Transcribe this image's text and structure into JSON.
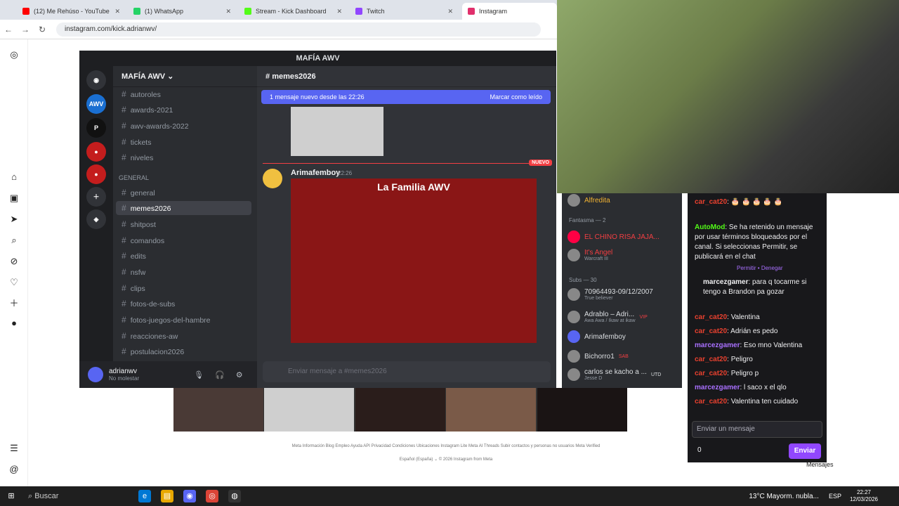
{
  "browser": {
    "tabs": [
      {
        "title": "(12) Me Rehúso - YouTube",
        "color": "#ff0000"
      },
      {
        "title": "(1) WhatsApp",
        "color": "#25d366"
      },
      {
        "title": "Stream - Kick Dashboard",
        "color": "#53fc18"
      },
      {
        "title": "Twitch",
        "color": "#9146ff"
      },
      {
        "title": "Instagram",
        "color": "#e1306c"
      }
    ],
    "url": "instagram.com/kick.adrianwv/"
  },
  "discord": {
    "window_title": "MAFÍA AWV",
    "server_name": "MAFÍA AWV",
    "channels": [
      "autoroles",
      "awards-2021",
      "awv-awards-2022",
      "tickets",
      "niveles"
    ],
    "category": "GENERAL",
    "channels2": [
      "general",
      "memes2026",
      "shitpost",
      "comandos",
      "edits",
      "nsfw",
      "clips",
      "fotos-de-subs",
      "fotos-juegos-del-hambre",
      "reacciones-aw",
      "postulacion2026"
    ],
    "current_channel": "memes2026",
    "new_bar": "1 mensaje nuevo desde las 22:26",
    "mark_read": "Marcar como leído",
    "nuevo": "NUEVO",
    "author": "Arimafemboy",
    "time": "22:26",
    "image_caption": "La Familia AWV",
    "composer_placeholder": "Enviar mensaje a #memes2026",
    "user": {
      "name": "adrianwv",
      "status": "No molestar"
    }
  },
  "members": {
    "items": [
      {
        "name": "Alfredita",
        "sub": ""
      },
      {
        "name": "EL CHINO RISA JAJA...",
        "sub": ""
      },
      {
        "name": "It's Angel",
        "sub": "Warcraft III"
      },
      {
        "name": "70964493-09/12/2007",
        "sub": "True believer"
      },
      {
        "name": "Adrablo – Adri...",
        "sub": "Awa Awa / Ikaw at ikaw"
      },
      {
        "name": "Arimafemboy",
        "sub": ""
      },
      {
        "name": "Bichorro1",
        "sub": ""
      },
      {
        "name": "carlos se kacho a ...",
        "sub": "Jesse D"
      }
    ],
    "cat1": "Fantasma — 2",
    "cat2": "Subs — 30",
    "badge_vip": "VIP",
    "badge_sab": "SAB",
    "badge_utd": "UTD"
  },
  "kick": {
    "lines": [
      {
        "user": "car_cat20",
        "text": ": 🎂 🎂 🎂 🎂 🎂"
      },
      {
        "user": "AutoMod",
        "text": ": Se ha retenido un mensaje por usar términos bloqueados por el canal. Si seleccionas Permitir, se publicará en el chat"
      },
      {
        "user": "marcezgamer",
        "text": ": para q tocarme si tengo a Brandon pa gozar"
      },
      {
        "user": "car_cat20",
        "text": ": Valentina"
      },
      {
        "user": "car_cat20",
        "text": ": Adrián es pedo"
      },
      {
        "user": "marcezgamer",
        "text": ": Eso mno Valentina"
      },
      {
        "user": "car_cat20",
        "text": ": Peligro"
      },
      {
        "user": "car_cat20",
        "text": ": Peligro p"
      },
      {
        "user": "marcezgamer",
        "text": ": l saco x el qlo"
      },
      {
        "user": "car_cat20",
        "text": ": Valentina ten cuidado"
      }
    ],
    "allow": "Permitir",
    "deny": "Denegar",
    "input_placeholder": "Enviar un mensaje",
    "send": "Enviar",
    "points": "0"
  },
  "footer": {
    "links": "Meta  Información  Blog  Empleo  Ayuda  API  Privacidad  Condiciones  Ubicaciones  Instagram Lite  Meta AI  Threads  Subir contactos y personas no usuarios  Meta Verified",
    "lang": "Español (España) ⌄   © 2026 Instagram from Meta"
  },
  "taskbar": {
    "search": "Buscar",
    "weather": "13°C  Mayorm. nubla...",
    "lang": "ESP",
    "time": "22:27",
    "date": "12/03/2026",
    "messages": "Mensajes"
  }
}
